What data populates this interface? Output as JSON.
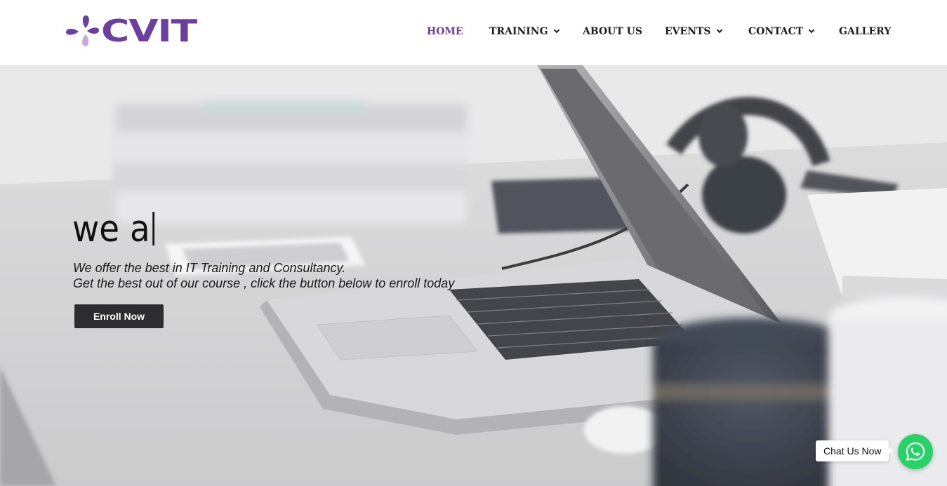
{
  "brand": {
    "logo_text": "CVIT",
    "accent_color": "#6a3fa0"
  },
  "nav": {
    "items": [
      {
        "label": "HOME",
        "active": true,
        "has_dropdown": false
      },
      {
        "label": "TRAINING",
        "active": false,
        "has_dropdown": true
      },
      {
        "label": "ABOUT US",
        "active": false,
        "has_dropdown": false
      },
      {
        "label": "EVENTS",
        "active": false,
        "has_dropdown": true
      },
      {
        "label": "CONTACT",
        "active": false,
        "has_dropdown": true
      },
      {
        "label": "GALLERY",
        "active": false,
        "has_dropdown": false
      }
    ]
  },
  "hero": {
    "headline": "we a",
    "tagline_line1": "We offer the best in IT Training and Consultancy.",
    "tagline_line2": "Get the best out of our course , click the button below to enroll today",
    "cta_label": "Enroll Now"
  },
  "chat": {
    "label": "Chat Us Now",
    "icon": "whatsapp-icon",
    "color": "#25d366"
  }
}
